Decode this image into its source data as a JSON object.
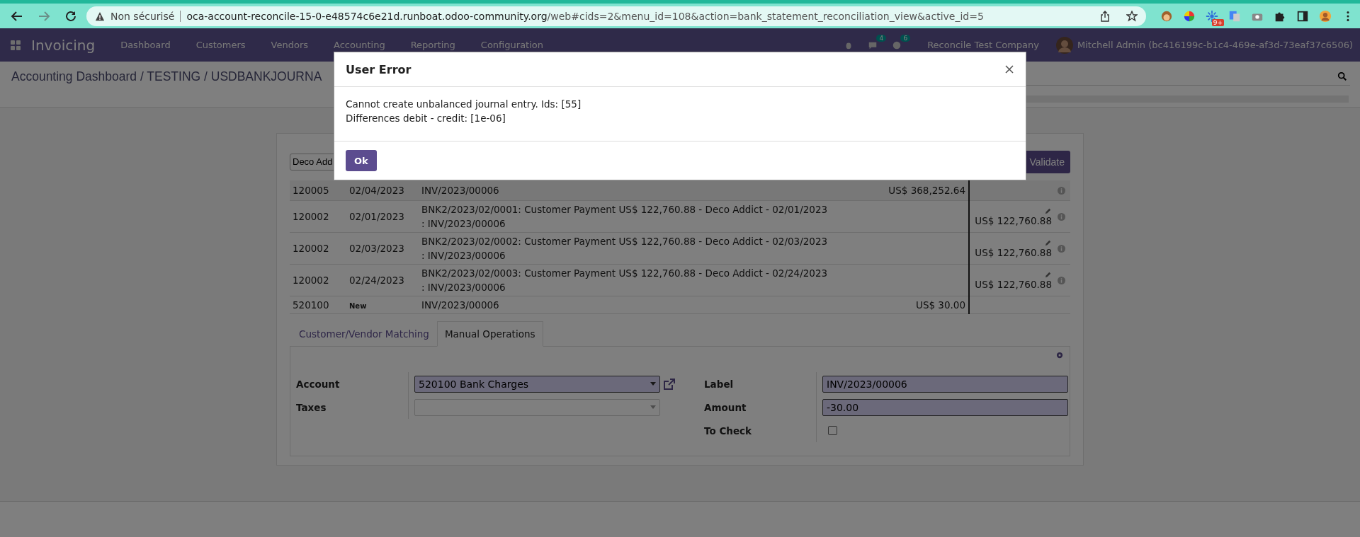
{
  "browser": {
    "not_secure": "Non sécurisé",
    "url_host": "oca-account-reconcile-15-0-e48574c6e21d.runboat.odoo-community.org",
    "url_path": "/web#cids=2&menu_id=108&action=bank_statement_reconciliation_view&active_id=5",
    "extension_badge": "9+"
  },
  "navbar": {
    "app": "Invoicing",
    "menu": [
      "Dashboard",
      "Customers",
      "Vendors",
      "Accounting",
      "Reporting",
      "Configuration"
    ],
    "badges": [
      "4",
      "6"
    ],
    "company": "Reconcile Test Company",
    "user": "Mitchell Admin (bc416199c-b1c4-469e-af3d-73eaf37c6506)"
  },
  "breadcrumb": "Accounting Dashboard / TESTING / USDBANKJOURNA",
  "partner_field": {
    "value": "Deco Add"
  },
  "validate_button": "Validate",
  "lines": [
    {
      "kind": "statement",
      "account": "120005",
      "date": "02/04/2023",
      "label": "INV/2023/00006",
      "debit": "US$ 368,252.64"
    },
    {
      "kind": "proposition",
      "account": "120002",
      "date": "02/01/2023",
      "label": "BNK2/2023/02/0001: Customer Payment US$ 122,760.88 - Deco Addict - 02/01/2023 : INV/2023/00006",
      "credit": "US$ 122,760.88"
    },
    {
      "kind": "proposition",
      "account": "120002",
      "date": "02/03/2023",
      "label": "BNK2/2023/02/0002: Customer Payment US$ 122,760.88 - Deco Addict - 02/03/2023 : INV/2023/00006",
      "credit": "US$ 122,760.88"
    },
    {
      "kind": "proposition",
      "account": "120002",
      "date": "02/24/2023",
      "label": "BNK2/2023/02/0003: Customer Payment US$ 122,760.88 - Deco Addict - 02/24/2023 : INV/2023/00006",
      "credit": "US$ 122,760.88"
    },
    {
      "kind": "new",
      "account": "520100",
      "date": "New",
      "label": "INV/2023/00006",
      "debit": "US$ 30.00"
    }
  ],
  "tabs": [
    {
      "label": "Customer/Vendor Matching",
      "selected": false
    },
    {
      "label": "Manual Operations",
      "selected": true
    }
  ],
  "form": {
    "account_label": "Account",
    "account_value": "520100 Bank Charges",
    "taxes_label": "Taxes",
    "label_label": "Label",
    "label_value": "INV/2023/00006",
    "amount_label": "Amount",
    "amount_value": "-30.00",
    "to_check_label": "To Check",
    "to_check": false
  },
  "dialog": {
    "title": "User Error",
    "messages": [
      "Cannot create unbalanced journal entry. Ids: [55]",
      "Differences debit - credit: [1e-06]"
    ],
    "button": "Ok"
  }
}
